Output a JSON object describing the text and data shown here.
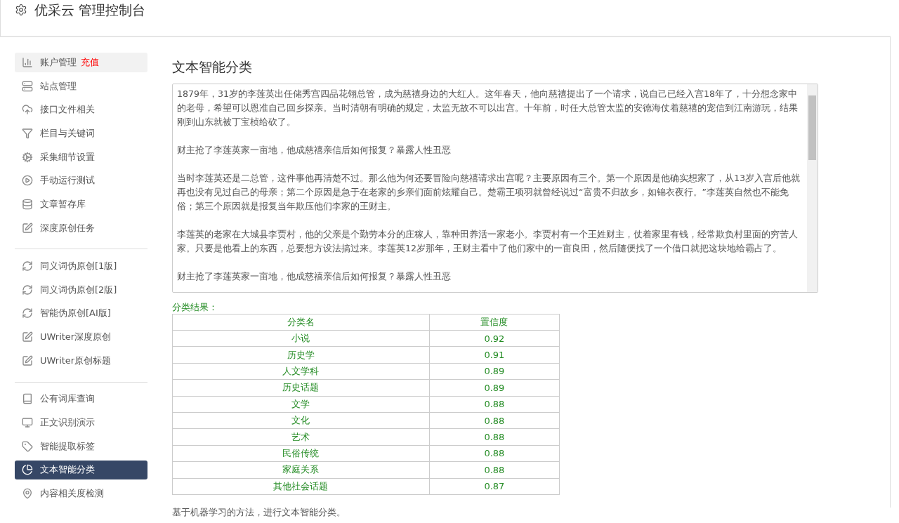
{
  "header": {
    "title": "优采云 管理控制台"
  },
  "sidebar": {
    "groups": [
      {
        "items": [
          {
            "label": "账户管理",
            "badge": "充值",
            "selected": false,
            "hovered": true
          },
          {
            "label": "站点管理",
            "selected": false,
            "hovered": false
          },
          {
            "label": "接口文件相关",
            "selected": false,
            "hovered": false
          },
          {
            "label": "栏目与关键词",
            "selected": false,
            "hovered": false
          },
          {
            "label": "采集细节设置",
            "selected": false,
            "hovered": false
          },
          {
            "label": "手动运行测试",
            "selected": false,
            "hovered": false
          },
          {
            "label": "文章暂存库",
            "selected": false,
            "hovered": false
          },
          {
            "label": "深度原创任务",
            "selected": false,
            "hovered": false
          }
        ]
      },
      {
        "items": [
          {
            "label": "同义词伪原创[1版]",
            "selected": false,
            "hovered": false
          },
          {
            "label": "同义词伪原创[2版]",
            "selected": false,
            "hovered": false
          },
          {
            "label": "智能伪原创[AI版]",
            "selected": false,
            "hovered": false
          },
          {
            "label": "UWriter深度原创",
            "selected": false,
            "hovered": false
          },
          {
            "label": "UWriter原创标题",
            "selected": false,
            "hovered": false
          }
        ]
      },
      {
        "items": [
          {
            "label": "公有词库查询",
            "selected": false,
            "hovered": false
          },
          {
            "label": "正文识别演示",
            "selected": false,
            "hovered": false
          },
          {
            "label": "智能提取标签",
            "selected": false,
            "hovered": false
          },
          {
            "label": "文本智能分类",
            "selected": true,
            "hovered": false
          },
          {
            "label": "内容相关度检测",
            "selected": false,
            "hovered": false
          }
        ]
      }
    ]
  },
  "main": {
    "title": "文本智能分类",
    "text_input": {
      "paragraphs": [
        "1879年，31岁的李莲英出任储秀宫四品花翎总管，成为慈禧身边的大红人。这年春天，他向慈禧提出了一个请求，说自己已经入宫18年了，十分想念家中的老母，希望可以恩准自己回乡探亲。当时清朝有明确的规定，太监无故不可以出宫。十年前，时任大总管太监的安德海仗着慈禧的宠信到江南游玩，结果刚到山东就被丁宝桢给砍了。",
        "财主抢了李莲英家一亩地，他成慈禧亲信后如何报复？暴露人性丑恶",
        "当时李莲英还是二总管，这件事他再清楚不过。那么他为何还要冒险向慈禧请求出宫呢？主要原因有三个。第一个原因是他确实想家了，从13岁入宫后他就再也没有见过自己的母亲；第二个原因是急于在老家的乡亲们面前炫耀自己。楚霸王项羽就曾经说过“富贵不归故乡，如锦衣夜行。”李莲英自然也不能免俗；第三个原因就是报复当年欺压他们李家的王财主。",
        "李莲英的老家在大城县李贾村，他的父亲是个勤劳本分的庄稼人，靠种田养活一家老小。李贾村有一个王姓财主，仗着家里有钱，经常欺负村里面的穷苦人家。只要是他看上的东西，总要想方设法搞过来。李莲英12岁那年，王财主看中了他们家中的一亩良田，然后随便找了一个借口就把这块地给霸占了。",
        "财主抢了李莲英家一亩地，他成慈禧亲信后如何报复？暴露人性丑恶"
      ]
    },
    "result_label": "分类结果：",
    "table": {
      "columns": [
        "分类名",
        "置信度"
      ],
      "rows": [
        [
          "小说",
          "0.92"
        ],
        [
          "历史学",
          "0.91"
        ],
        [
          "人文学科",
          "0.89"
        ],
        [
          "历史话题",
          "0.89"
        ],
        [
          "文学",
          "0.88"
        ],
        [
          "文化",
          "0.88"
        ],
        [
          "艺术",
          "0.88"
        ],
        [
          "民俗传统",
          "0.88"
        ],
        [
          "家庭关系",
          "0.88"
        ],
        [
          "其他社会话题",
          "0.87"
        ]
      ]
    },
    "footnote": "基于机器学习的方法，进行文本智能分类。"
  }
}
